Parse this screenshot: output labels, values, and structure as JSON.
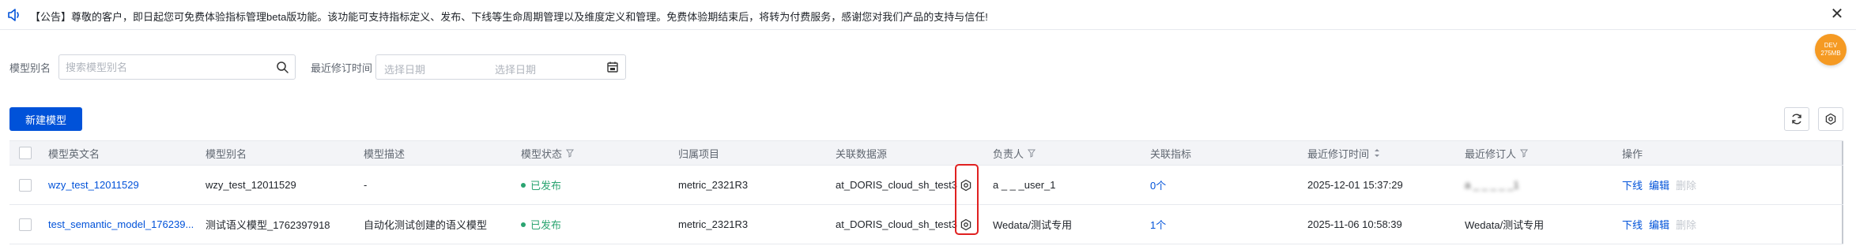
{
  "notice": {
    "text": "【公告】尊敬的客户，即日起您可免费体验指标管理beta版功能。该功能可支持指标定义、发布、下线等生命周期管理以及维度定义和管理。免费体验期结束后，将转为付费服务，感谢您对我们产品的支持与信任!",
    "close": "✕"
  },
  "dev_badge": {
    "line1": "DEV",
    "line2": "275MB"
  },
  "filters": {
    "alias_label": "模型别名",
    "alias_placeholder": "搜索模型别名",
    "modified_label": "最近修订时间",
    "start_placeholder": "选择日期",
    "end_placeholder": "选择日期"
  },
  "toolbar": {
    "new_model": "新建模型"
  },
  "table": {
    "headers": {
      "name": "模型英文名",
      "alias": "模型别名",
      "desc": "模型描述",
      "status": "模型状态",
      "project": "归属项目",
      "datasource": "关联数据源",
      "owner": "负责人",
      "metrics": "关联指标",
      "modified_time": "最近修订时间",
      "modifier": "最近修订人",
      "actions": "操作"
    },
    "rows": [
      {
        "name": "wzy_test_12011529",
        "alias": "wzy_test_12011529",
        "desc": "-",
        "status": "已发布",
        "project": "metric_2321R3",
        "datasource": "at_DORIS_cloud_sh_test3",
        "owner": "a    _ _ _user_1",
        "metrics": "0个",
        "modified_time": "2025-12-01 15:37:29",
        "modifier": "a  _  _  _  _ _1",
        "actions": {
          "offline": "下线",
          "edit": "编辑",
          "delete": "删除"
        }
      },
      {
        "name": "test_semantic_model_176239...",
        "alias": "测试语义模型_1762397918",
        "desc": "自动化测试创建的语义模型",
        "status": "已发布",
        "project": "metric_2321R3",
        "datasource": "at_DORIS_cloud_sh_test3",
        "owner": "Wedata/测试专用",
        "metrics": "1个",
        "modified_time": "2025-11-06 10:58:39",
        "modifier": "Wedata/测试专用",
        "actions": {
          "offline": "下线",
          "edit": "编辑",
          "delete": "删除"
        }
      }
    ]
  },
  "colors": {
    "primary": "#0052d9",
    "success": "#2ba471",
    "highlight": "#e02020",
    "badge": "#f59a23"
  }
}
